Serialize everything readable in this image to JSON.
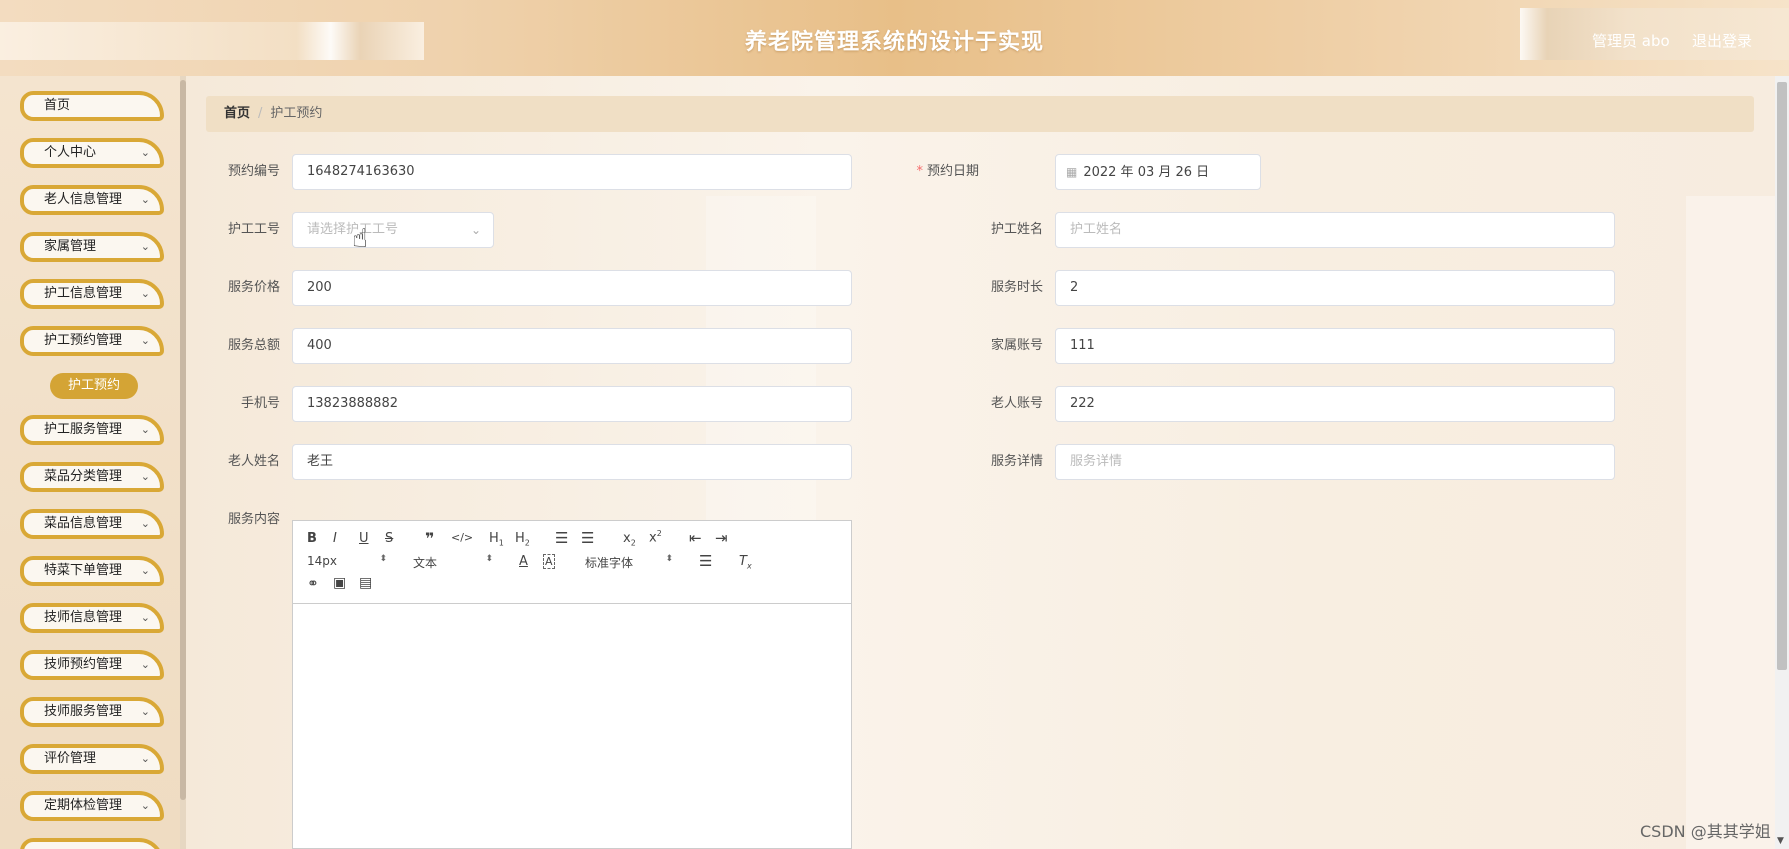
{
  "header": {
    "title": "养老院管理系统的设计于实现",
    "admin_label": "管理员 abo",
    "logout": "退出登录"
  },
  "sidebar": {
    "items": [
      {
        "label": "首页",
        "has_chevron": false
      },
      {
        "label": "个人中心",
        "has_chevron": true
      },
      {
        "label": "老人信息管理",
        "has_chevron": true
      },
      {
        "label": "家属管理",
        "has_chevron": true
      },
      {
        "label": "护工信息管理",
        "has_chevron": true
      },
      {
        "label": "护工预约管理",
        "has_chevron": true
      },
      {
        "label": "护工服务管理",
        "has_chevron": true
      },
      {
        "label": "菜品分类管理",
        "has_chevron": true
      },
      {
        "label": "菜品信息管理",
        "has_chevron": true
      },
      {
        "label": "特菜下单管理",
        "has_chevron": true
      },
      {
        "label": "技师信息管理",
        "has_chevron": true
      },
      {
        "label": "技师预约管理",
        "has_chevron": true
      },
      {
        "label": "技师服务管理",
        "has_chevron": true
      },
      {
        "label": "评价管理",
        "has_chevron": true
      },
      {
        "label": "定期体检管理",
        "has_chevron": true
      }
    ],
    "active_sub": "护工预约",
    "chevron": "⌄"
  },
  "breadcrumb": {
    "home": "首页",
    "separator": "/",
    "current": "护工预约"
  },
  "form": {
    "booking_no": {
      "label": "预约编号",
      "value": "1648274163630"
    },
    "booking_date": {
      "label": "预约日期",
      "required": "*",
      "value": "2022 年 03 月 26 日"
    },
    "worker_no": {
      "label": "护工工号",
      "placeholder": "请选择护工工号"
    },
    "worker_name": {
      "label": "护工姓名",
      "placeholder": "护工姓名"
    },
    "service_price": {
      "label": "服务价格",
      "value": "200"
    },
    "service_hours": {
      "label": "服务时长",
      "value": "2"
    },
    "service_total": {
      "label": "服务总额",
      "value": "400"
    },
    "family_account": {
      "label": "家属账号",
      "value": "111"
    },
    "phone": {
      "label": "手机号",
      "value": "13823888882"
    },
    "elder_account": {
      "label": "老人账号",
      "value": "222"
    },
    "elder_name": {
      "label": "老人姓名",
      "value": "老王"
    },
    "service_detail": {
      "label": "服务详情",
      "placeholder": "服务详情"
    },
    "service_content": {
      "label": "服务内容"
    }
  },
  "editor": {
    "font_size": "14px",
    "text_style": "文本",
    "font_family": "标准字体"
  },
  "watermark": "CSDN @其其学姐",
  "colors": {
    "accent": "#d9a836",
    "active_pill": "#d4a435",
    "required": "#f56c6c"
  },
  "icons": {
    "select_arrow": "chevron-down-icon",
    "date": "calendar-icon",
    "cursor": "hand-pointer-icon"
  }
}
